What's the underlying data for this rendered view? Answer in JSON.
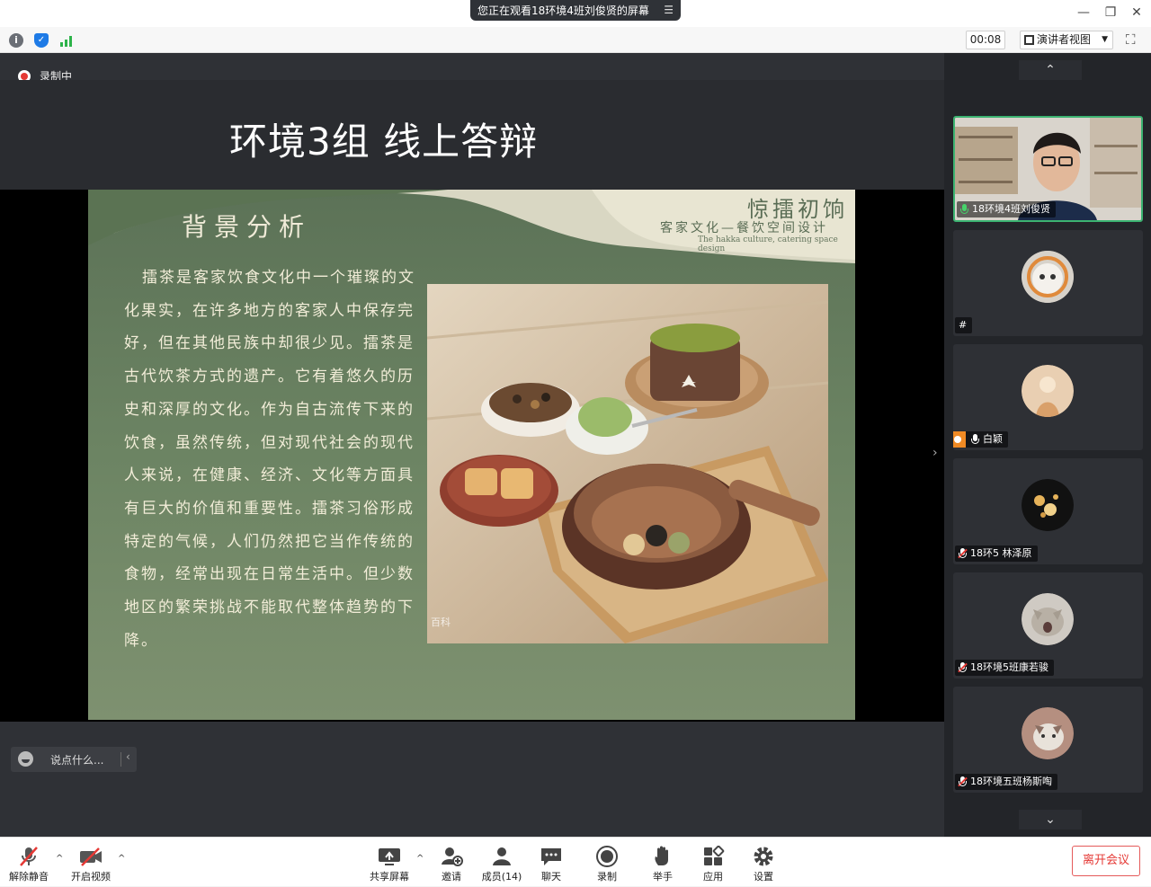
{
  "titlebar": {
    "share_notice": "您正在观看18环境4班刘俊贤的屏幕",
    "menu_icon": "menu-icon",
    "controls": [
      "minimize-icon",
      "restore-icon",
      "close-icon"
    ]
  },
  "toolbar": {
    "timer": "00:08",
    "view_label": "演讲者视图",
    "icons": [
      "info-icon",
      "shield-icon",
      "signal-icon",
      "fullscreen-icon"
    ]
  },
  "main": {
    "recording_label": "录制中",
    "slide": {
      "title": "环境3组 线上答辩",
      "heading": "背景分析",
      "brand_title": "惊擂初饷",
      "brand_subtitle": "客家文化—餐饮空间设计",
      "brand_english": "The hakka culture, catering space design",
      "body": "擂茶是客家饮食文化中一个璀璨的文化果实，在许多地方的客家人中保存完好，但在其他民族中却很少见。擂茶是古代饮茶方式的遗产。它有着悠久的历史和深厚的文化。作为自古流传下来的饮食，虽然传统，但对现代社会的现代人来说，在健康、经济、文化等方面具有巨大的价值和重要性。擂茶习俗形成特定的气候，人们仍然把它当作传统的食物，经常出现在日常生活中。但少数地区的繁荣挑战不能取代整体趋势的下降。",
      "photo_watermark": "百科"
    },
    "chat_placeholder": "说点什么..."
  },
  "participants": [
    {
      "name": "18环境4班刘俊贤",
      "mic": "on",
      "video": true
    },
    {
      "name": "#",
      "mic": "none",
      "video": false
    },
    {
      "name": "白颖",
      "mic": "on",
      "host": true,
      "video": false
    },
    {
      "name": "18环5 林泽原",
      "mic": "muted",
      "video": false
    },
    {
      "name": "18环境5班康若骏",
      "mic": "muted",
      "video": false
    },
    {
      "name": "18环境五班杨斯啕",
      "mic": "muted",
      "video": false
    }
  ],
  "bottombar": {
    "unmute": "解除静音",
    "start_video": "开启视频",
    "share_screen": "共享屏幕",
    "invite": "邀请",
    "members": "成员(14)",
    "chat": "聊天",
    "record": "录制",
    "raise_hand": "举手",
    "apps": "应用",
    "settings": "设置",
    "leave": "离开会议"
  },
  "colors": {
    "recording_red": "#e53935",
    "active_speaker": "#3cb371",
    "slide_green": "#667a5c",
    "leave_red": "#e53935"
  }
}
